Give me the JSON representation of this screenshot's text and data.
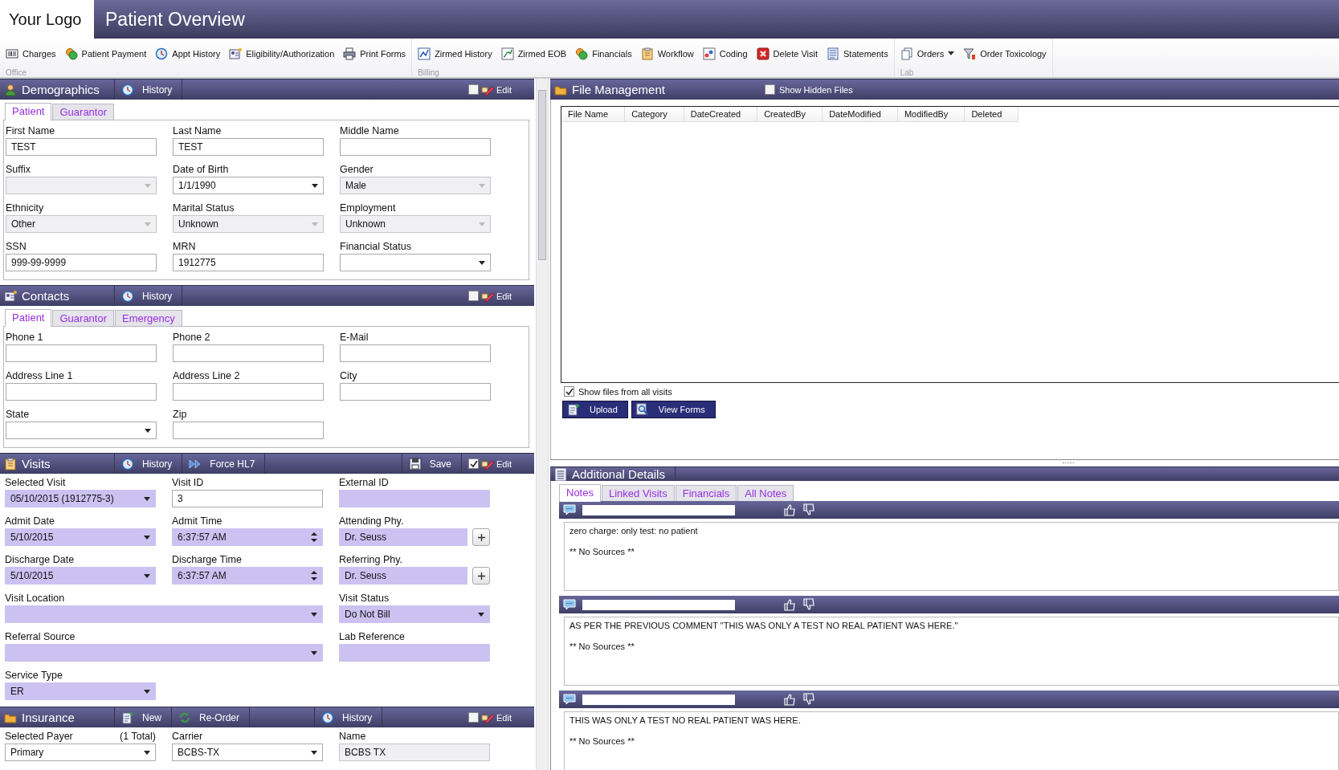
{
  "app": {
    "logo": "Your Logo",
    "title": "Patient Overview"
  },
  "toolbar": [
    {
      "group": "Office",
      "items": [
        {
          "label": "Charges",
          "dropdown": false
        },
        {
          "label": "Patient Payment",
          "dropdown": false
        },
        {
          "label": "Appt History",
          "dropdown": false
        },
        {
          "label": "Eligibility/Authorization",
          "dropdown": false
        },
        {
          "label": "Print Forms",
          "dropdown": false
        }
      ]
    },
    {
      "group": "Billing",
      "items": [
        {
          "label": "Zirmed History",
          "dropdown": false
        },
        {
          "label": "Zirmed EOB",
          "dropdown": false
        },
        {
          "label": "Financials",
          "dropdown": false
        },
        {
          "label": "Workflow",
          "dropdown": false
        },
        {
          "label": "Coding",
          "dropdown": false
        },
        {
          "label": "Delete Visit",
          "dropdown": false
        },
        {
          "label": "Statements",
          "dropdown": false
        }
      ]
    },
    {
      "group": "Lab",
      "items": [
        {
          "label": "Orders",
          "dropdown": true
        },
        {
          "label": "Order Toxicology",
          "dropdown": false
        }
      ]
    }
  ],
  "sections": [
    {
      "title": "Demographics",
      "buttons": [
        {
          "label": "History",
          "kind": "history",
          "spaced": false
        }
      ],
      "edit": {
        "label": "Edit",
        "checked": false
      },
      "tabs": [
        {
          "label": "Patient",
          "selected": true
        },
        {
          "label": "Guarantor",
          "selected": false
        }
      ],
      "rows": [
        [
          {
            "label": "First Name",
            "value": "TEST",
            "kind": "text",
            "disabled": false,
            "highlighted": false
          },
          {
            "label": "Last Name",
            "value": "TEST",
            "kind": "text",
            "disabled": false,
            "highlighted": false
          },
          {
            "label": "Middle Name",
            "kind": "text",
            "disabled": false,
            "highlighted": false
          }
        ],
        [
          {
            "label": "Suffix",
            "kind": "select",
            "disabled": true,
            "highlighted": false
          },
          {
            "label": "Date of Birth",
            "value": "1/1/1990",
            "kind": "select",
            "disabled": false,
            "highlighted": false
          },
          {
            "label": "Gender",
            "value": "Male",
            "kind": "select",
            "disabled": true,
            "highlighted": false
          }
        ],
        [
          {
            "label": "Ethnicity",
            "value": "Other",
            "kind": "select",
            "disabled": true,
            "highlighted": false
          },
          {
            "label": "Marital Status",
            "value": "Unknown",
            "kind": "select",
            "disabled": true,
            "highlighted": false
          },
          {
            "label": "Employment",
            "value": "Unknown",
            "kind": "select",
            "disabled": true,
            "highlighted": false
          }
        ],
        [
          {
            "label": "SSN",
            "value": "999-99-9999",
            "kind": "text",
            "disabled": false,
            "highlighted": false
          },
          {
            "label": "MRN",
            "value": "1912775",
            "kind": "text",
            "disabled": false,
            "highlighted": false
          },
          {
            "label": "Financial Status",
            "kind": "select",
            "disabled": false,
            "highlighted": false
          }
        ]
      ]
    },
    {
      "title": "Contacts",
      "buttons": [
        {
          "label": "History",
          "kind": "history",
          "spaced": false
        }
      ],
      "edit": {
        "label": "Edit",
        "checked": false
      },
      "tabs": [
        {
          "label": "Patient",
          "selected": true
        },
        {
          "label": "Guarantor",
          "selected": false
        },
        {
          "label": "Emergency",
          "selected": false
        }
      ],
      "rows": [
        [
          {
            "label": "Phone 1",
            "kind": "text",
            "disabled": false,
            "highlighted": false
          },
          {
            "label": "Phone 2",
            "kind": "text",
            "disabled": false,
            "highlighted": false
          },
          {
            "label": "E-Mail",
            "kind": "text",
            "disabled": false,
            "highlighted": false
          }
        ],
        [
          {
            "label": "Address Line 1",
            "kind": "text",
            "disabled": false,
            "highlighted": false
          },
          {
            "label": "Address Line 2",
            "kind": "text",
            "disabled": false,
            "highlighted": false
          },
          {
            "label": "City",
            "kind": "text",
            "disabled": false,
            "highlighted": false
          }
        ],
        [
          {
            "label": "State",
            "kind": "select",
            "disabled": false,
            "highlighted": false
          },
          {
            "label": "Zip",
            "kind": "text",
            "disabled": false,
            "highlighted": false
          }
        ]
      ]
    },
    {
      "title": "Visits",
      "buttons": [
        {
          "label": "History",
          "kind": "history",
          "spaced": false
        },
        {
          "label": "Force HL7",
          "kind": "forward",
          "spaced": false
        }
      ],
      "save": "Save",
      "edit": {
        "label": "Edit",
        "checked": true
      },
      "rows": [
        [
          {
            "label": "Selected Visit",
            "value": "05/10/2015 (1912775-3)",
            "kind": "select",
            "disabled": false,
            "highlighted": true
          },
          {
            "label": "Visit ID",
            "value": "3",
            "kind": "text",
            "disabled": false,
            "highlighted": false
          },
          {
            "label": "External ID",
            "kind": "text",
            "disabled": false,
            "highlighted": true
          }
        ],
        [
          {
            "label": "Admit Date",
            "value": "5/10/2015",
            "kind": "select",
            "disabled": false,
            "highlighted": true
          },
          {
            "label": "Admit Time",
            "value": "6:37:57 AM",
            "kind": "time",
            "disabled": false,
            "highlighted": true
          },
          {
            "label": "Attending Phy.",
            "value": "Dr. Seuss",
            "kind": "lookup",
            "disabled": false,
            "highlighted": true
          }
        ],
        [
          {
            "label": "Discharge Date",
            "value": "5/10/2015",
            "kind": "select",
            "disabled": false,
            "highlighted": true
          },
          {
            "label": "Discharge Time",
            "value": "6:37:57 AM",
            "kind": "time",
            "disabled": false,
            "highlighted": true
          },
          {
            "label": "Referring Phy.",
            "value": "Dr. Seuss",
            "kind": "lookup",
            "disabled": false,
            "highlighted": true
          }
        ],
        [
          {
            "label": "Visit Location",
            "kind": "select",
            "wide": true,
            "disabled": false,
            "highlighted": true
          },
          {
            "label": "Visit Status",
            "value": "Do Not Bill",
            "kind": "select",
            "disabled": false,
            "highlighted": true
          }
        ],
        [
          {
            "label": "Referral Source",
            "kind": "select",
            "wide": true,
            "disabled": false,
            "highlighted": true
          },
          {
            "label": "Lab Reference",
            "kind": "text",
            "disabled": false,
            "highlighted": true
          }
        ],
        [
          {
            "label": "Service Type",
            "value": "ER",
            "kind": "select",
            "disabled": false,
            "highlighted": true
          }
        ]
      ]
    },
    {
      "title": "Insurance",
      "buttons": [
        {
          "label": "New",
          "kind": "new",
          "spaced": false
        },
        {
          "label": "Re-Order",
          "kind": "reorder",
          "spaced": false
        },
        {
          "label": "History",
          "kind": "history",
          "spaced": true
        }
      ],
      "edit": {
        "label": "Edit",
        "checked": false
      },
      "rows": [
        [
          {
            "label": "Selected Payer",
            "note": "(1 Total)",
            "value": "Primary",
            "kind": "select",
            "disabled": false,
            "highlighted": false
          },
          {
            "label": "Carrier",
            "value": "BCBS-TX",
            "kind": "select",
            "disabled": false,
            "highlighted": false
          },
          {
            "label": "Name",
            "value": "BCBS TX",
            "kind": "text",
            "disabled": true,
            "highlighted": false
          }
        ]
      ]
    }
  ],
  "file_management": {
    "title": "File Management",
    "show_hidden": {
      "label": "Show Hidden Files",
      "checked": false
    },
    "columns": [
      "File Name",
      "Category",
      "DateCreated",
      "CreatedBy",
      "DateModified",
      "ModifiedBy",
      "Deleted"
    ],
    "all_visits": {
      "label": "Show files from all visits",
      "checked": true
    },
    "buttons": [
      {
        "label": "Upload",
        "kind": "upload"
      },
      {
        "label": "View Forms",
        "kind": "view"
      }
    ]
  },
  "additional_details": {
    "title": "Additional Details",
    "tabs": [
      {
        "label": "Notes",
        "selected": true
      },
      {
        "label": "Linked Visits",
        "selected": false
      },
      {
        "label": "Financials",
        "selected": false
      },
      {
        "label": "All Notes",
        "selected": false
      }
    ],
    "notes": [
      {
        "text": "zero charge: only test: no patient",
        "sources": "** No Sources **"
      },
      {
        "text": "AS PER THE PREVIOUS COMMENT  \"THIS WAS ONLY A TEST NO REAL PATIENT WAS HERE.\"",
        "sources": "** No Sources **"
      },
      {
        "text": "THIS WAS ONLY A TEST NO REAL PATIENT WAS HERE.",
        "sources": "** No Sources **"
      }
    ]
  }
}
